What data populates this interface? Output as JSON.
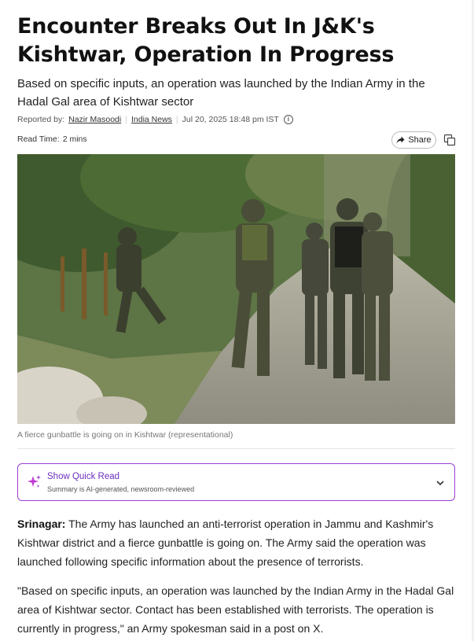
{
  "article": {
    "headline": "Encounter Breaks Out In J&K's Kishtwar, Operation In Progress",
    "subheadline": "Based on specific inputs, an operation was launched by the Indian Army in the Hadal Gal area of Kishtwar sector",
    "byline": {
      "reported_by_label": "Reported by:",
      "author": "Nazir Masoodi",
      "section": "India News",
      "timestamp": "Jul 20, 2025 18:48 pm IST"
    },
    "read_time_label": "Read Time:",
    "read_time_value": "2 mins",
    "share_label": "Share",
    "image_caption": "A fierce gunbattle is going on in Kishtwar (representational)",
    "quick_read": {
      "title": "Show Quick Read",
      "subtitle": "Summary is AI-generated, newsroom-reviewed"
    },
    "body": [
      {
        "dateline": "Srinagar:",
        "text": " The Army has launched an anti-terrorist operation in Jammu and Kashmir's Kishtwar district and a fierce gunbattle is going on. The Army said the operation was launched following specific information about the presence of terrorists."
      },
      {
        "text": "\"Based on specific inputs, an operation was launched by the Indian Army in the Hadal Gal area of Kishtwar sector. Contact has been established with terrorists. The operation is currently in progress,\" an Army spokesman said in a post on X."
      }
    ]
  },
  "colors": {
    "quick_read_accent": "#9b3fd6",
    "quick_read_title": "#6b2fbf"
  },
  "icons": [
    "info-icon",
    "share-icon",
    "copy-icon",
    "sparkle-icon",
    "chevron-down-icon"
  ]
}
